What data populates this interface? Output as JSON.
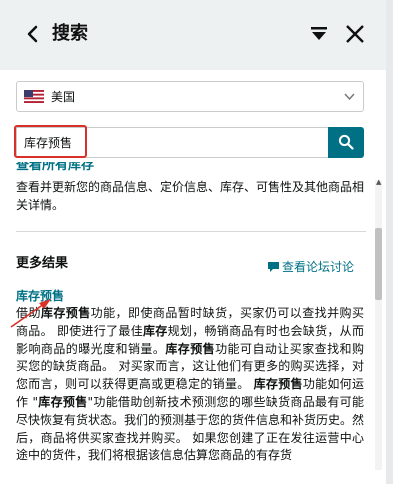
{
  "header": {
    "title": "搜索",
    "back_icon": "chevron-left-icon",
    "pin_icon": "pin-to-top-icon",
    "close_icon": "close-icon"
  },
  "country_select": {
    "value": "美国",
    "flag_icon": "us-flag-icon"
  },
  "search": {
    "value": "库存预售",
    "button_icon": "search-icon",
    "accent": "#007185"
  },
  "top_result": {
    "title_clipped": "查看所有库存",
    "description": "查看并更新您的商品信息、定价信息、库存、可售性及其他商品相关详情。"
  },
  "more_results": {
    "heading": "更多结果",
    "forum_link": "查看论坛讨论"
  },
  "result": {
    "title": "库存预售",
    "body": [
      {
        "t": "借助"
      },
      {
        "b": "库存预售"
      },
      {
        "t": "功能，即使商品暂时缺货，买家仍可以查找并购买商品。 即使进行了最佳"
      },
      {
        "b": "库存"
      },
      {
        "t": "规划，畅销商品有时也会缺货，从而影响商品的曝光度和销量。"
      },
      {
        "b": "库存预售"
      },
      {
        "t": "功能可自动让买家查找和购买您的缺货商品。 对买家而言，这让他们有更多的购买选择，对您而言，则可以获得更高或更稳定的销量。 "
      },
      {
        "b": "库存预售"
      },
      {
        "t": "功能如何运作 \""
      },
      {
        "b": "库存预售"
      },
      {
        "t": "\"功能借助创新技术预测您的哪些缺货商品最有可能尽快恢复有货状态。我们的预测基于您的货件信息和补货历史。然后，商品将供买家查找并购买。 如果您创建了正在发往运营中心途中的货件，我们将根据该信息估算您商品的有存货"
      }
    ]
  },
  "annotation_color": "#d9302a"
}
